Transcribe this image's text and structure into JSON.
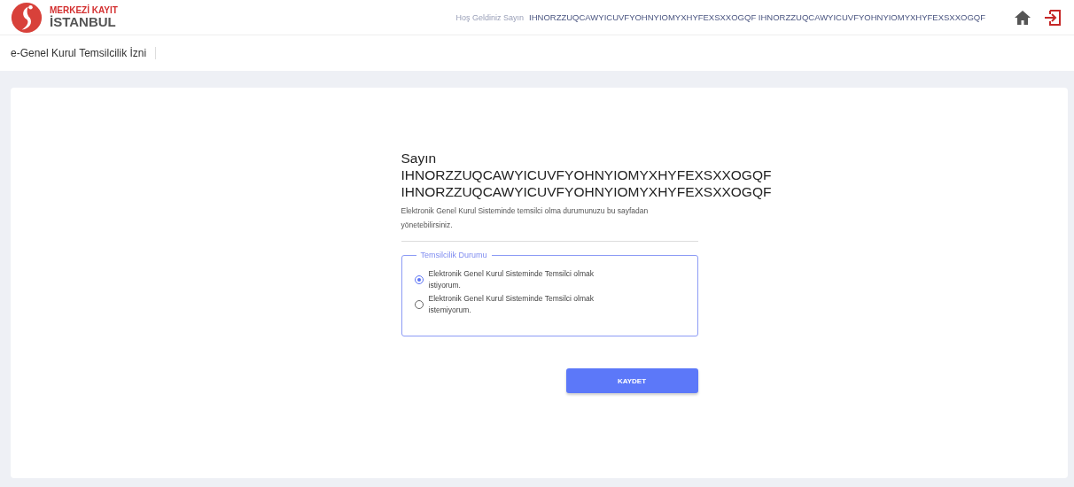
{
  "header": {
    "logo": {
      "line_1": "MERKEZİ KAYIT",
      "line_2": "İSTANBUL"
    },
    "welcome_label": "Hoş Geldiniz Sayın",
    "user_name": "IHNORZZUQCAWYICUVFYOHNYIOMYXHYFEXSXXOGQF IHNORZZUQCAWYICUVFYOHNYIOMYXHYFEXSXXOGQF"
  },
  "page_title": "e-Genel Kurul Temsilcilik İzni",
  "form": {
    "salutation": "Sayın",
    "name": "IHNORZZUQCAWYICUVFYOHNYIOMYXHYFEXSXXOGQF IHNORZZUQCAWYICUVFYOHNYIOMYXHYFEXSXXOGQF",
    "description": "Elektronik Genel Kurul Sisteminde temsilci olma durumunuzu bu sayfadan yönetebilirsiniz.",
    "group_label": "Temsilcilik Durumu",
    "options": [
      {
        "label": "Elektronik Genel Kurul Sisteminde Temsilci olmak istiyorum.",
        "selected": true
      },
      {
        "label": "Elektronik Genel Kurul Sisteminde Temsilci olmak istemiyorum.",
        "selected": false
      }
    ],
    "save_button": "KAYDET"
  }
}
